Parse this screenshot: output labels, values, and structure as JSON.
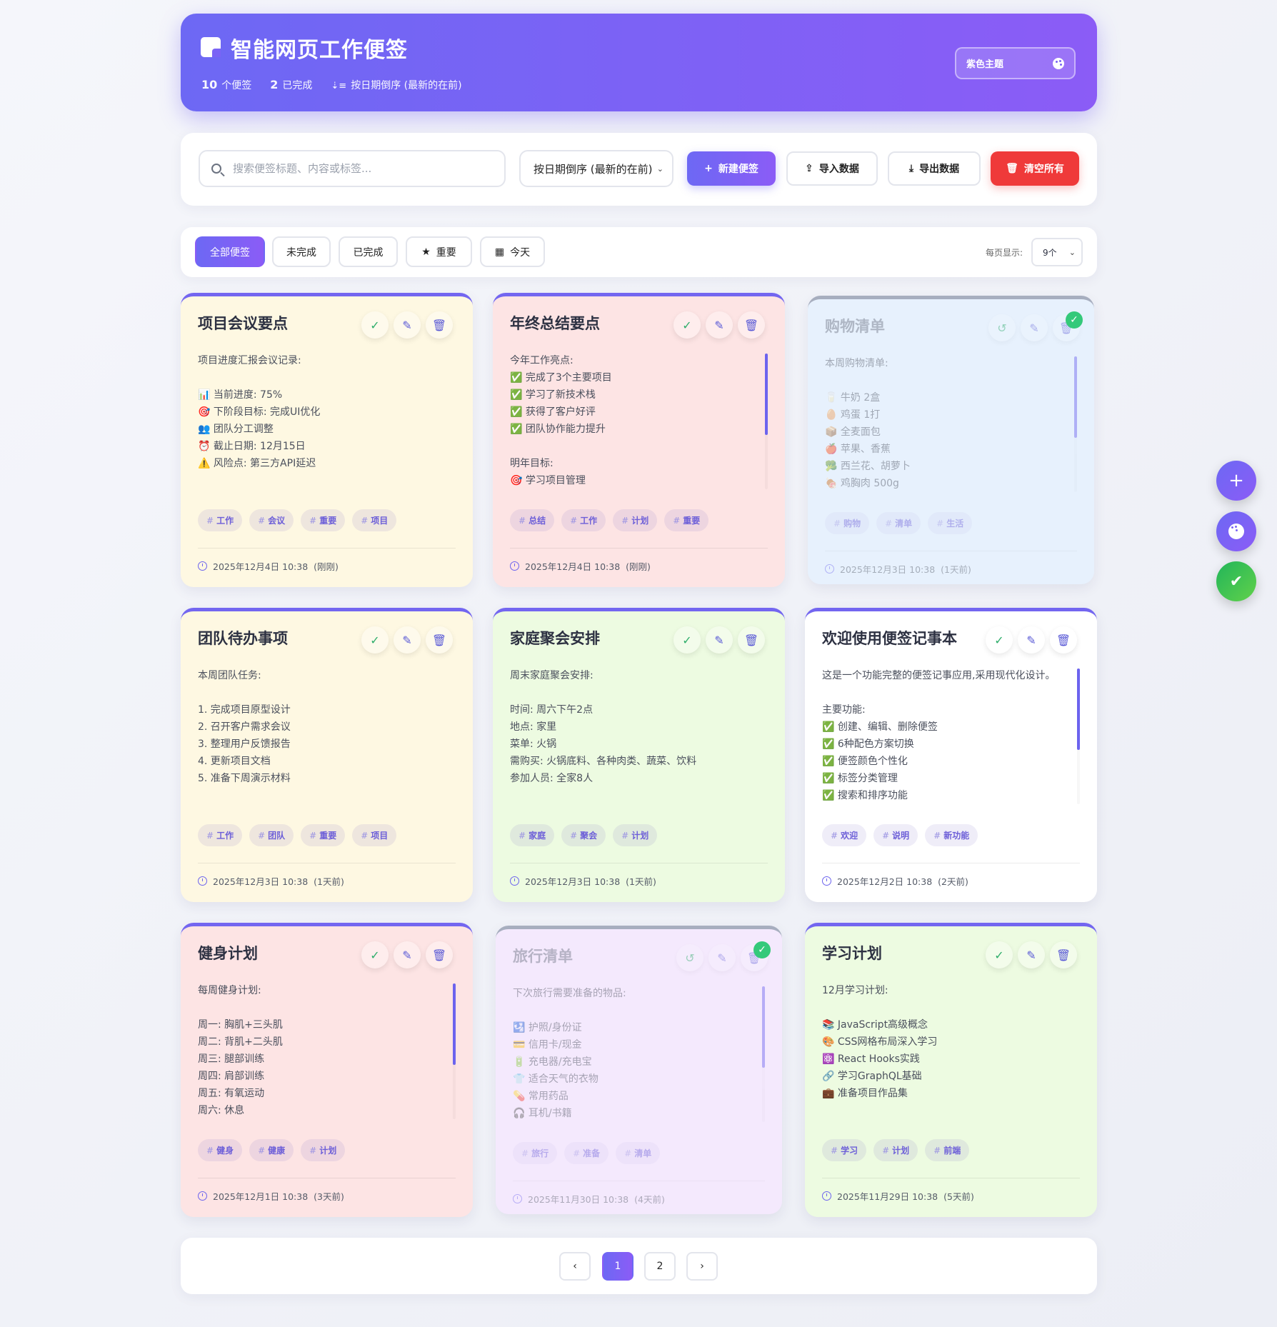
{
  "header": {
    "title": "智能网页工作便签",
    "stats": {
      "total_count": "10",
      "total_label": "个便签",
      "done_count": "2",
      "done_label": "已完成",
      "sort_label": "按日期倒序 (最新的在前)"
    },
    "theme_label": "紫色主题"
  },
  "toolbar": {
    "search_placeholder": "搜索便签标题、内容或标签...",
    "sort_value": "按日期倒序 (最新的在前)",
    "new_label": "新建便签",
    "import_label": "导入数据",
    "export_label": "导出数据",
    "clear_label": "清空所有"
  },
  "filters": {
    "items": [
      {
        "label": "全部便签",
        "active": true
      },
      {
        "label": "未完成"
      },
      {
        "label": "已完成"
      },
      {
        "label": "重要",
        "icon": "star-icon"
      },
      {
        "label": "今天",
        "icon": "calendar-icon"
      }
    ],
    "per_page_label": "每页显示:",
    "per_page_value": "9个"
  },
  "notes": [
    {
      "title": "项目会议要点",
      "color": "yellow",
      "done": false,
      "scroll": false,
      "body": "项目进度汇报会议记录:\n\n📊 当前进度: 75%\n🎯 下阶段目标: 完成UI优化\n👥 团队分工调整\n⏰ 截止日期: 12月15日\n⚠️ 风险点: 第三方API延迟",
      "tags": [
        "工作",
        "会议",
        "重要",
        "项目"
      ],
      "date": "2025年12月4日 10:38",
      "ago": "(刚刚)"
    },
    {
      "title": "年终总结要点",
      "color": "pink",
      "done": false,
      "scroll": true,
      "body": "今年工作亮点:\n✅ 完成了3个主要项目\n✅ 学习了新技术栈\n✅ 获得了客户好评\n✅ 团队协作能力提升\n\n明年目标:\n🎯 学习项目管理",
      "tags": [
        "总结",
        "工作",
        "计划",
        "重要"
      ],
      "date": "2025年12月4日 10:38",
      "ago": "(刚刚)"
    },
    {
      "title": "购物清单",
      "color": "blue",
      "done": true,
      "scroll": true,
      "body": "本周购物清单:\n\n🥛 牛奶 2盒\n🥚 鸡蛋 1打\n📦 全麦面包\n🍎 苹果、香蕉\n🥦 西兰花、胡萝卜\n🍖 鸡胸肉 500g",
      "tags": [
        "购物",
        "清单",
        "生活"
      ],
      "date": "2025年12月3日 10:38",
      "ago": "(1天前)"
    },
    {
      "title": "团队待办事项",
      "color": "yellow",
      "done": false,
      "scroll": false,
      "body": "本周团队任务:\n\n1. 完成项目原型设计\n2. 召开客户需求会议\n3. 整理用户反馈报告\n4. 更新项目文档\n5. 准备下周演示材料",
      "tags": [
        "工作",
        "团队",
        "重要",
        "项目"
      ],
      "date": "2025年12月3日 10:38",
      "ago": "(1天前)"
    },
    {
      "title": "家庭聚会安排",
      "color": "green",
      "done": false,
      "scroll": false,
      "body": "周末家庭聚会安排:\n\n时间: 周六下午2点\n地点: 家里\n菜单: 火锅\n需购买: 火锅底料、各种肉类、蔬菜、饮料\n参加人员: 全家8人",
      "tags": [
        "家庭",
        "聚会",
        "计划"
      ],
      "date": "2025年12月3日 10:38",
      "ago": "(1天前)"
    },
    {
      "title": "欢迎使用便签记事本",
      "color": "white",
      "done": false,
      "scroll": true,
      "body": "这是一个功能完整的便签记事应用,采用现代化设计。\n\n主要功能:\n✅ 创建、编辑、删除便签\n✅ 6种配色方案切换\n✅ 便签颜色个性化\n✅ 标签分类管理\n✅ 搜索和排序功能",
      "tags": [
        "欢迎",
        "说明",
        "新功能"
      ],
      "date": "2025年12月2日 10:38",
      "ago": "(2天前)"
    },
    {
      "title": "健身计划",
      "color": "pink",
      "done": false,
      "scroll": true,
      "body": "每周健身计划:\n\n周一: 胸肌+三头肌\n周二: 背肌+二头肌\n周三: 腿部训练\n周四: 肩部训练\n周五: 有氧运动\n周六: 休息",
      "tags": [
        "健身",
        "健康",
        "计划"
      ],
      "date": "2025年12月1日 10:38",
      "ago": "(3天前)"
    },
    {
      "title": "旅行清单",
      "color": "purple",
      "done": true,
      "scroll": true,
      "body": "下次旅行需要准备的物品:\n\n🛂 护照/身份证\n💳 信用卡/现金\n🔋 充电器/充电宝\n👕 适合天气的衣物\n💊 常用药品\n🎧 耳机/书籍",
      "tags": [
        "旅行",
        "准备",
        "清单"
      ],
      "date": "2025年11月30日 10:38",
      "ago": "(4天前)"
    },
    {
      "title": "学习计划",
      "color": "green",
      "done": false,
      "scroll": false,
      "body": "12月学习计划:\n\n📚 JavaScript高级概念\n🎨 CSS网格布局深入学习\n⚛️ React Hooks实践\n🔗 学习GraphQL基础\n💼 准备项目作品集",
      "tags": [
        "学习",
        "计划",
        "前端"
      ],
      "date": "2025年11月29日 10:38",
      "ago": "(5天前)"
    }
  ],
  "pagination": {
    "prev": "‹",
    "pages": [
      "1",
      "2"
    ],
    "current": "1",
    "next": "›"
  },
  "colors": {
    "accent": "#7366f0",
    "danger": "#ef3a3a",
    "success": "#34c97a"
  }
}
